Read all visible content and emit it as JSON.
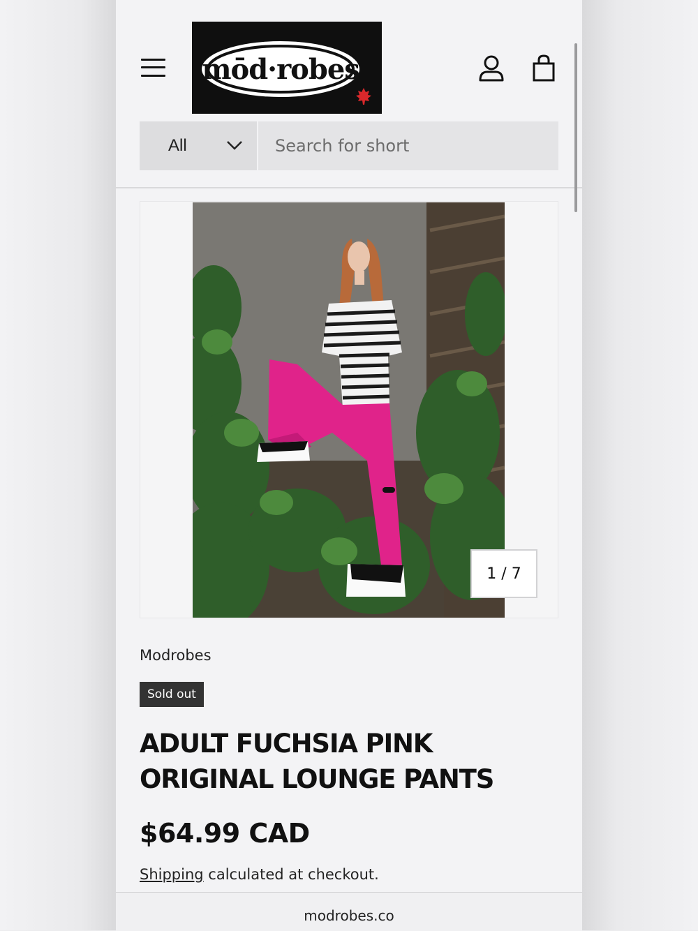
{
  "brand": {
    "logo_text": "mōd·robes"
  },
  "header": {
    "menu_icon": "hamburger-menu-icon",
    "account_icon": "user-account-icon",
    "cart_icon": "shopping-bag-icon"
  },
  "search": {
    "category": "All",
    "placeholder": "Search for short"
  },
  "product": {
    "image_counter": "1 / 7",
    "vendor": "Modrobes",
    "badge": "Sold out",
    "title": "ADULT FUCHSIA PINK ORIGINAL LOUNGE PANTS",
    "price": "$64.99 CAD",
    "shipping_link": "Shipping",
    "shipping_rest": " calculated at checkout."
  },
  "browser": {
    "url": "modrobes.co"
  },
  "colors": {
    "accent_pink": "#e0238a",
    "badge_bg": "#333333",
    "text": "#111111"
  }
}
